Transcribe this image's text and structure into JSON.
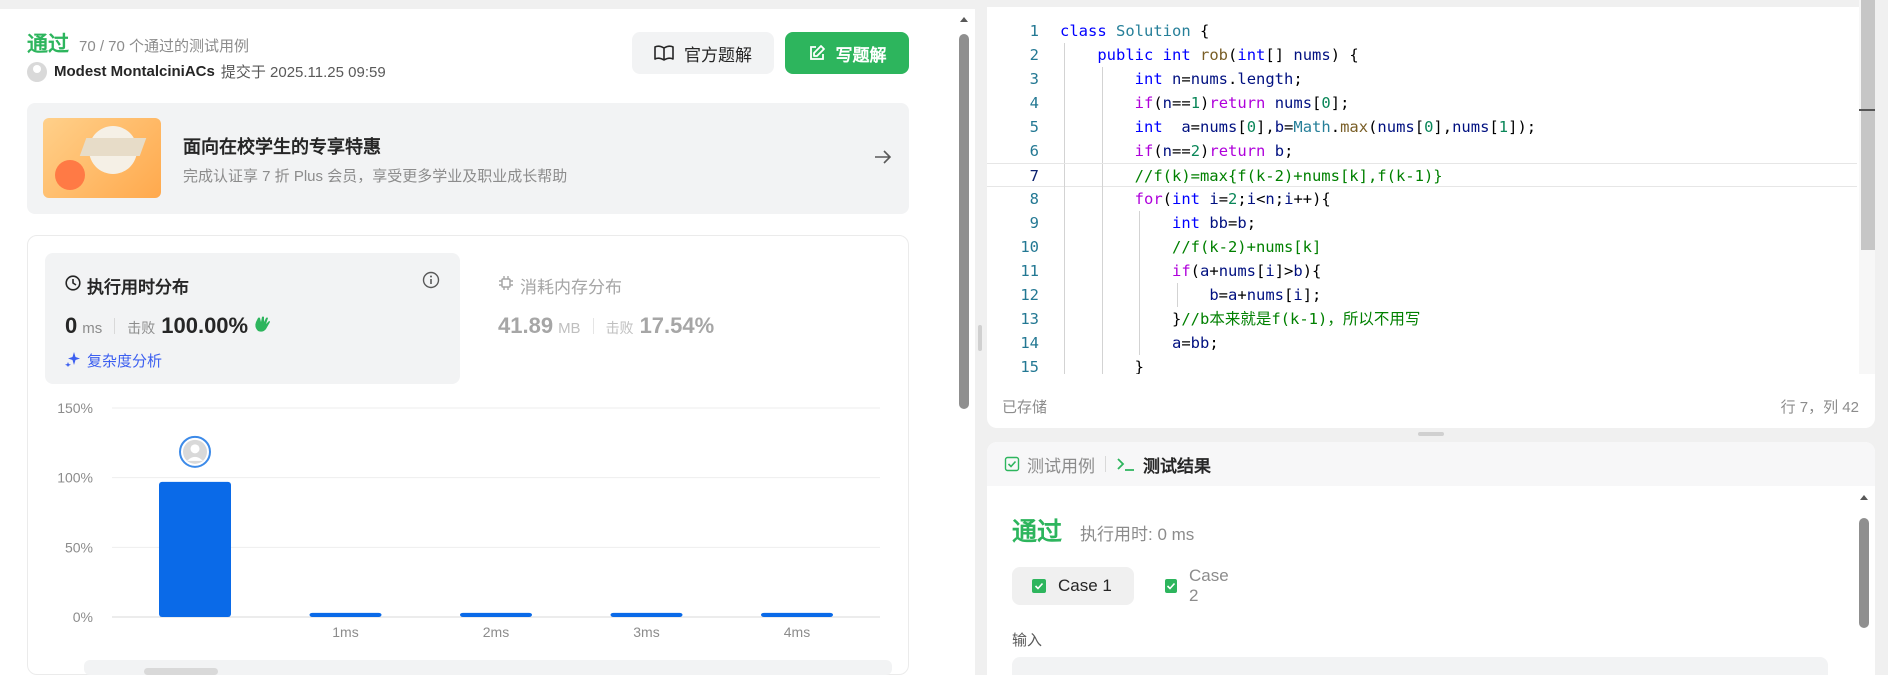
{
  "submission": {
    "status": "通过",
    "testcases": "70 / 70 个通过的测试用例",
    "author": "Modest MontalciniACs",
    "submitted_at": "提交于 2025.11.25 09:59",
    "official_solution_label": "官方题解",
    "write_solution_label": "写题解"
  },
  "promo": {
    "title": "面向在校学生的专享特惠",
    "subtitle": "完成认证享 7 折 Plus 会员，享受更多学业及职业成长帮助"
  },
  "runtime": {
    "title": "执行用时分布",
    "value": "0",
    "unit": "ms",
    "beat_label": "击败",
    "beat_value": "100.00%",
    "complexity_link": "复杂度分析"
  },
  "memory": {
    "title": "消耗内存分布",
    "value": "41.89",
    "unit": "MB",
    "beat_label": "击败",
    "beat_value": "17.54%"
  },
  "chart_data": {
    "type": "bar",
    "categories": [
      "0ms",
      "1ms",
      "2ms",
      "3ms",
      "4ms"
    ],
    "category_labels": [
      "",
      "1ms",
      "2ms",
      "3ms",
      "4ms"
    ],
    "values": [
      97,
      3,
      3,
      3,
      3
    ],
    "y_ticks": [
      "150%",
      "100%",
      "50%",
      "0%"
    ],
    "ylim": [
      0,
      150
    ],
    "highlight_index": 0,
    "bar_color": "#0a6ae8",
    "grid": true
  },
  "editor": {
    "lines": [
      {
        "no": "1",
        "code": "class Solution {"
      },
      {
        "no": "2",
        "code": "    public int rob(int[] nums) {"
      },
      {
        "no": "3",
        "code": "        int n=nums.length;"
      },
      {
        "no": "4",
        "code": "        if(n==1)return nums[0];"
      },
      {
        "no": "5",
        "code": "        int  a=nums[0],b=Math.max(nums[0],nums[1]);"
      },
      {
        "no": "6",
        "code": "        if(n==2)return b;"
      },
      {
        "no": "7",
        "code": "        //f(k)=max{f(k-2)+nums[k],f(k-1)}"
      },
      {
        "no": "8",
        "code": "        for(int i=2;i<n;i++){"
      },
      {
        "no": "9",
        "code": "            int bb=b;"
      },
      {
        "no": "10",
        "code": "            //f(k-2)+nums[k]"
      },
      {
        "no": "11",
        "code": "            if(a+nums[i]>b){"
      },
      {
        "no": "12",
        "code": "                b=a+nums[i];"
      },
      {
        "no": "13",
        "code": "            }//b本来就是f(k-1)，所以不用写"
      },
      {
        "no": "14",
        "code": "            a=bb;"
      },
      {
        "no": "15",
        "code": "        }"
      }
    ],
    "current_line": 7,
    "saved_status": "已存储",
    "cursor_position": "行 7，列 42"
  },
  "results": {
    "tab_testcase": "测试用例",
    "tab_result": "测试结果",
    "status": "通过",
    "runtime": "执行用时: 0 ms",
    "cases": [
      "Case 1",
      "Case 2"
    ],
    "input_label": "输入"
  },
  "colors": {
    "accent_green": "#2db55d",
    "link_blue": "#3c5ff0",
    "bar_blue": "#0a6ae8"
  }
}
